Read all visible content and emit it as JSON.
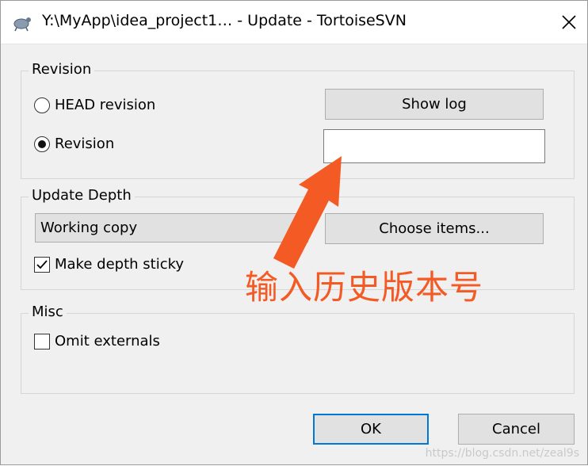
{
  "window": {
    "title": "Y:\\MyApp\\idea_project1… - Update - TortoiseSVN"
  },
  "revision_group": {
    "legend": "Revision",
    "head_option": "HEAD revision",
    "revision_option": "Revision",
    "show_log_label": "Show log",
    "revision_value": "",
    "selected": "revision"
  },
  "depth_group": {
    "legend": "Update Depth",
    "depth_value": "Working copy",
    "choose_items_label": "Choose items...",
    "sticky_label": "Make depth sticky",
    "sticky_checked": true
  },
  "misc_group": {
    "legend": "Misc",
    "omit_externals_label": "Omit externals",
    "omit_checked": false
  },
  "buttons": {
    "ok": "OK",
    "cancel": "Cancel"
  },
  "annotation": {
    "text": "输入历史版本号",
    "color": "#f35a24"
  },
  "watermark": "https://blog.csdn.net/zeal9s",
  "icons": [
    "tortoise-icon",
    "close-icon",
    "arrow-icon"
  ]
}
